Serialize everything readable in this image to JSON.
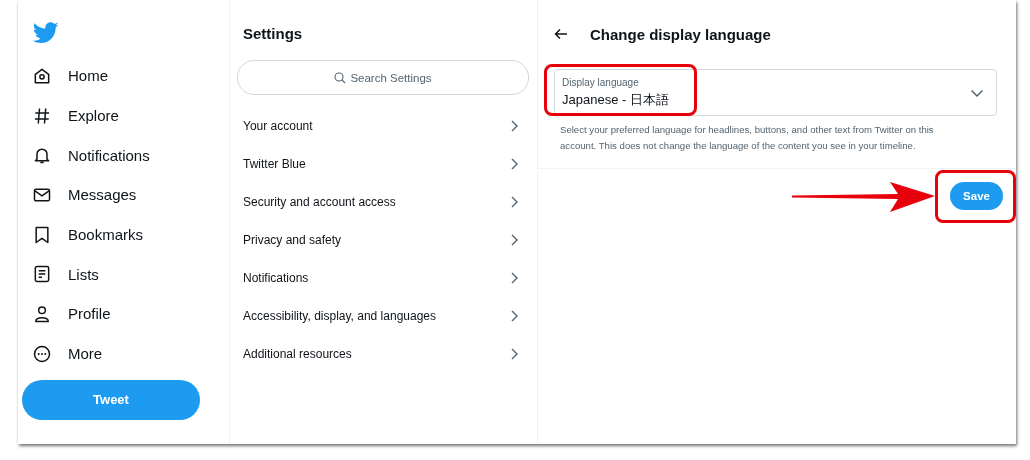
{
  "nav": {
    "items": [
      {
        "label": "Home"
      },
      {
        "label": "Explore"
      },
      {
        "label": "Notifications"
      },
      {
        "label": "Messages"
      },
      {
        "label": "Bookmarks"
      },
      {
        "label": "Lists"
      },
      {
        "label": "Profile"
      },
      {
        "label": "More"
      }
    ],
    "tweet_button": "Tweet"
  },
  "settings": {
    "title": "Settings",
    "search": {
      "placeholder": "Search Settings"
    },
    "items": [
      {
        "label": "Your account"
      },
      {
        "label": "Twitter Blue"
      },
      {
        "label": "Security and account access"
      },
      {
        "label": "Privacy and safety"
      },
      {
        "label": "Notifications"
      },
      {
        "label": "Accessibility, display, and languages"
      },
      {
        "label": "Additional resources"
      }
    ]
  },
  "detail": {
    "title": "Change display language",
    "select": {
      "label": "Display language",
      "value": "Japanese - 日本語"
    },
    "description": "Select your preferred language for headlines, buttons, and other text from Twitter on this account. This does not change the language of the content you see in your timeline.",
    "save_button": "Save"
  }
}
